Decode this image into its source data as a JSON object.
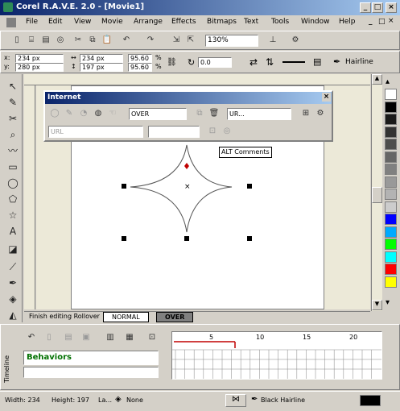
{
  "window": {
    "title": "Corel R.A.V.E. 2.0 - [Movie1]",
    "min": "_",
    "max": "□",
    "close": "×"
  },
  "menu": [
    "File",
    "Edit",
    "View",
    "Movie",
    "Arrange",
    "Effects",
    "Bitmaps",
    "Text",
    "Tools",
    "Window",
    "Help"
  ],
  "toolbar": {
    "zoom": "130%"
  },
  "props": {
    "x": "234 px",
    "y": "280 px",
    "w": "234 px",
    "h": "197 px",
    "sx": "95.60",
    "sy": "95.60",
    "pct": "%",
    "angle": "0.0",
    "outline": "Hairline"
  },
  "internet": {
    "title": "Internet",
    "behavior": "OVER",
    "url_combo": "UR...",
    "url_field": "URL",
    "close": "×"
  },
  "canvas": {
    "tooltip": "ALT Comments"
  },
  "tabs": {
    "finish": "Finish editing Rollover",
    "normal": "NORMAL",
    "over": "OVER"
  },
  "timeline": {
    "label": "Timeline",
    "behaviors": "Behaviors",
    "ticks": [
      "5",
      "10",
      "15",
      "20"
    ]
  },
  "status": {
    "width": "Width: 234",
    "height": "Height: 197",
    "layer": "La...",
    "fill": "None",
    "outline": "Black  Hairline"
  },
  "palette": [
    "#ffffff",
    "#000000",
    "#1a1a1a",
    "#333333",
    "#4d4d4d",
    "#666666",
    "#808080",
    "#999999",
    "#b3b3b3",
    "#cccccc",
    "#0000ff",
    "#00aaff",
    "#00ff00",
    "#00ffff",
    "#ff0000",
    "#ffff00"
  ]
}
